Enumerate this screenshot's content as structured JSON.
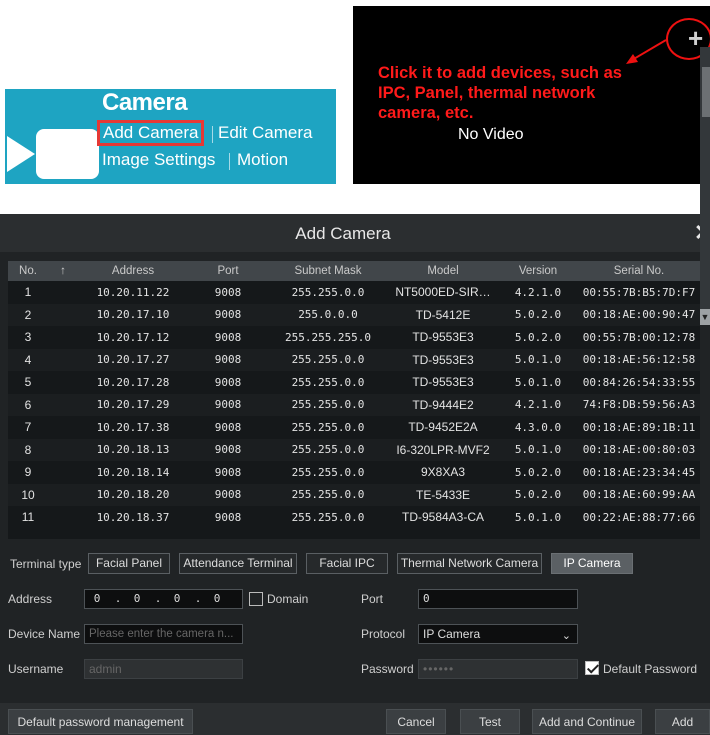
{
  "camera_menu": {
    "title": "Camera",
    "add_camera": "Add Camera",
    "edit_camera": "Edit Camera",
    "image_settings": "Image Settings",
    "motion": "Motion"
  },
  "live_view": {
    "callout_line1": "Click  it to add devices, such as",
    "callout_line2": "IPC,  Panel,  thermal network",
    "callout_line3": "camera, etc.",
    "no_video": "No Video",
    "plus": "+",
    "callout_color": "#ff1a1a"
  },
  "dialog": {
    "title": "Add Camera",
    "close": "✕",
    "columns": [
      "No.",
      "Address",
      "Port",
      "Subnet Mask",
      "Model",
      "Version",
      "Serial No."
    ],
    "sort_icon": "↑",
    "rows": [
      [
        "1",
        "10.20.11.22",
        "9008",
        "255.255.0.0",
        "NT5000ED-SIR…",
        "4.2.1.0",
        "00:55:7B:B5:7D:F7"
      ],
      [
        "2",
        "10.20.17.10",
        "9008",
        "255.0.0.0",
        "TD-5412E",
        "5.0.2.0",
        "00:18:AE:00:90:47"
      ],
      [
        "3",
        "10.20.17.12",
        "9008",
        "255.255.255.0",
        "TD-9553E3",
        "5.0.2.0",
        "00:55:7B:00:12:78"
      ],
      [
        "4",
        "10.20.17.27",
        "9008",
        "255.255.0.0",
        "TD-9553E3",
        "5.0.1.0",
        "00:18:AE:56:12:58"
      ],
      [
        "5",
        "10.20.17.28",
        "9008",
        "255.255.0.0",
        "TD-9553E3",
        "5.0.1.0",
        "00:84:26:54:33:55"
      ],
      [
        "6",
        "10.20.17.29",
        "9008",
        "255.255.0.0",
        "TD-9444E2",
        "4.2.1.0",
        "74:F8:DB:59:56:A3"
      ],
      [
        "7",
        "10.20.17.38",
        "9008",
        "255.255.0.0",
        "TD-9452E2A",
        "4.3.0.0",
        "00:18:AE:89:1B:11"
      ],
      [
        "8",
        "10.20.18.13",
        "9008",
        "255.255.0.0",
        "I6-320LPR-MVF2",
        "5.0.1.0",
        "00:18:AE:00:80:03"
      ],
      [
        "9",
        "10.20.18.14",
        "9008",
        "255.255.0.0",
        "9X8XA3",
        "5.0.2.0",
        "00:18:AE:23:34:45"
      ],
      [
        "10",
        "10.20.18.20",
        "9008",
        "255.255.0.0",
        "TE-5433E",
        "5.0.2.0",
        "00:18:AE:60:99:AA"
      ],
      [
        "11",
        "10.20.18.37",
        "9008",
        "255.255.0.0",
        "TD-9584A3-CA",
        "5.0.1.0",
        "00:22:AE:88:77:66"
      ]
    ],
    "terminal_type_label": "Terminal type",
    "terminal_types": [
      "Facial Panel",
      "Attendance Terminal",
      "Facial IPC",
      "Thermal Network Camera",
      "IP Camera"
    ],
    "selected_terminal_type": "IP Camera",
    "address_label": "Address",
    "address_octets": [
      "0",
      "0",
      "0",
      "0"
    ],
    "domain_label": "Domain",
    "port_label": "Port",
    "port_value": "0",
    "device_name_label": "Device Name",
    "device_name_placeholder": "Please enter the camera n...",
    "protocol_label": "Protocol",
    "protocol_value": "IP Camera",
    "username_label": "Username",
    "username_value": "admin",
    "password_label": "Password",
    "password_value": "••••••",
    "default_password_label": "Default Password",
    "default_password_checked": true,
    "footer": {
      "default_password_management": "Default password management",
      "cancel": "Cancel",
      "test": "Test",
      "add_and_continue": "Add and Continue",
      "add": "Add"
    }
  }
}
